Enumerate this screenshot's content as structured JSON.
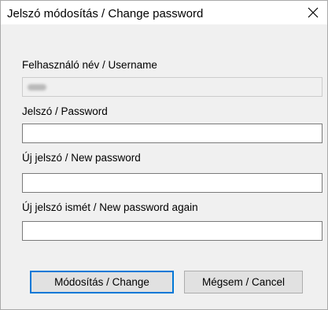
{
  "window": {
    "title": "Jelszó módosítás / Change password"
  },
  "icons": {
    "close": "close-icon"
  },
  "form": {
    "username_label": "Felhasználó név / Username",
    "username_value": "",
    "password_label": "Jelszó / Password",
    "password_value": "",
    "new_password_label": "Új jelszó / New password",
    "new_password_value": "",
    "new_password_again_label": "Új jelszó ismét / New password again",
    "new_password_again_value": ""
  },
  "buttons": {
    "change_label": "Módosítás / Change",
    "cancel_label": "Mégsem / Cancel"
  },
  "colors": {
    "accent": "#0078d7",
    "dialog_background": "#f0f0f0",
    "button_background": "#e1e1e1"
  }
}
